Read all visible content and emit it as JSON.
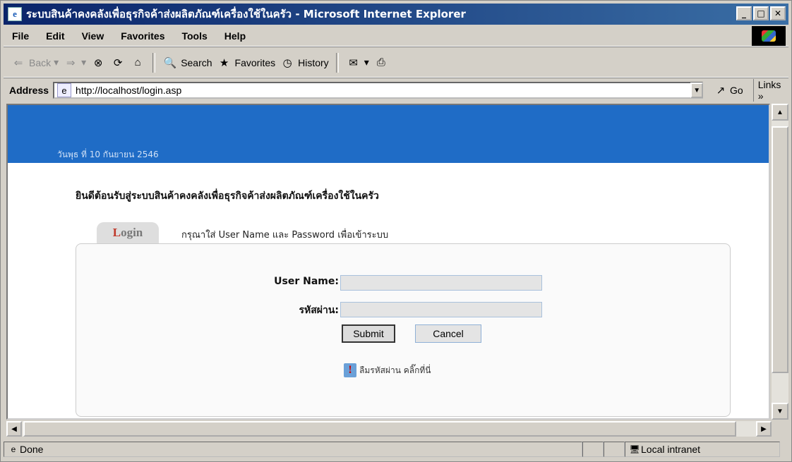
{
  "window": {
    "title": "ระบบสินค้าคงคลังเพื่อธุรกิจค้าส่งผลิตภัณฑ์เครื่องใช้ในครัว - Microsoft Internet Explorer",
    "controls": {
      "minimize": "_",
      "maximize": "□",
      "close": "✕"
    }
  },
  "menu": [
    "File",
    "Edit",
    "View",
    "Favorites",
    "Tools",
    "Help"
  ],
  "toolbar": {
    "back": "Back",
    "search": "Search",
    "favorites": "Favorites",
    "history": "History"
  },
  "address": {
    "label": "Address",
    "url": "http://localhost/login.asp",
    "go": "Go",
    "links": "Links"
  },
  "page": {
    "date": "วันพุธ ที่ 10 กันยายน 2546",
    "welcome": "ยินดีต้อนรับสู่ระบบสินค้าคงคลังเพื่อธุรกิจค้าส่งผลิตภัณฑ์เครื่องใช้ในครัว",
    "login_tab_first": "L",
    "login_tab_rest": "ogin",
    "instruction": "กรุณาใส่ User Name และ Password เพื่อเข้าระบบ",
    "username_label": "User Name:",
    "password_label": "รหัสผ่าน:",
    "username_value": "",
    "password_value": "",
    "submit": "Submit",
    "cancel": "Cancel",
    "forgot": "ลืมรหัสผ่าน คลิ๊กที่นี่"
  },
  "status": {
    "left": "Done",
    "zone": "Local intranet"
  },
  "colors": {
    "banner": "#1f6cc6",
    "titlebar_start": "#0a246a",
    "titlebar_end": "#3a6ea5",
    "chrome": "#d4d0c8"
  }
}
